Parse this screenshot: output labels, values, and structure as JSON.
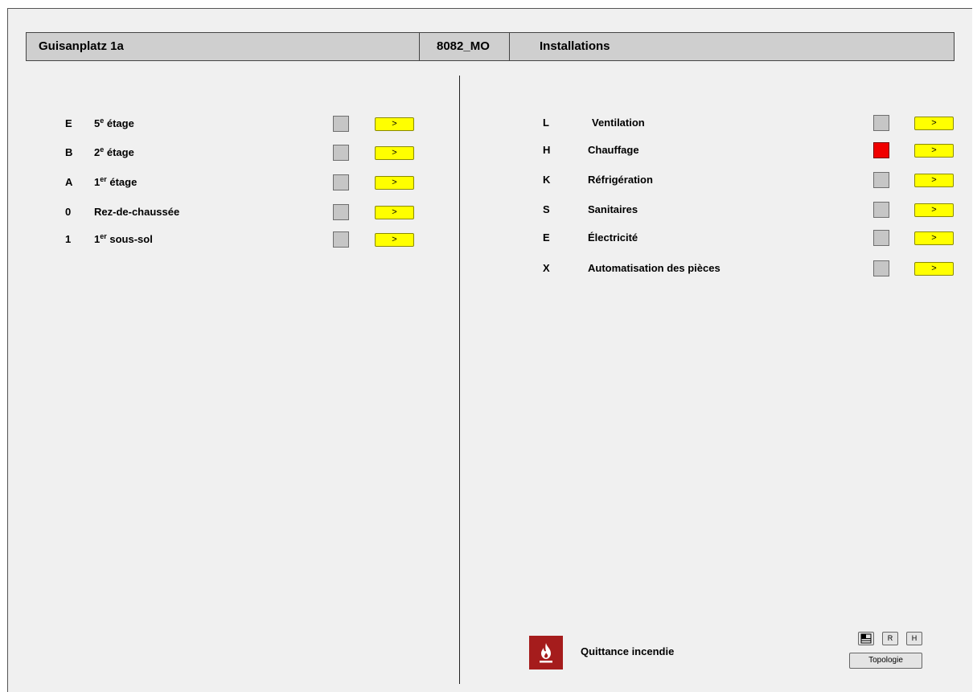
{
  "header": {
    "building": "Guisanplatz 1a",
    "code": "8082_MO",
    "section": "Installations"
  },
  "floors": [
    {
      "code": "E",
      "base": "5",
      "sup": "e",
      "rest": " étage",
      "status": "normal",
      "go": ">"
    },
    {
      "code": "B",
      "base": "2",
      "sup": "e",
      "rest": " étage",
      "status": "normal",
      "go": ">"
    },
    {
      "code": "A",
      "base": "1",
      "sup": "er",
      "rest": " étage",
      "status": "normal",
      "go": ">"
    },
    {
      "code": "0",
      "base": "Rez-de-chaussée",
      "sup": "",
      "rest": "",
      "status": "normal",
      "go": ">"
    },
    {
      "code": "1",
      "base": "1",
      "sup": "er",
      "rest": " sous-sol",
      "status": "normal",
      "go": ">"
    }
  ],
  "installations": [
    {
      "code": "L",
      "label": "Ventilation",
      "status": "normal",
      "go": ">"
    },
    {
      "code": "H",
      "label": "Chauffage",
      "status": "alarm",
      "go": ">"
    },
    {
      "code": "K",
      "label": "Réfrigération",
      "status": "normal",
      "go": ">"
    },
    {
      "code": "S",
      "label": "Sanitaires",
      "status": "normal",
      "go": ">"
    },
    {
      "code": "E",
      "label": "Électricité",
      "status": "normal",
      "go": ">"
    },
    {
      "code": "X",
      "label": "Automatisation des pièces",
      "status": "normal",
      "go": ">"
    }
  ],
  "footer": {
    "fire_label": "Quittance incendie",
    "btn_r": "R",
    "btn_h": "H",
    "topology": "Topologie"
  },
  "colors": {
    "alarm": "#f00000",
    "normal": "#c6c6c6",
    "button": "#ffff00",
    "fire": "#a51c1c"
  }
}
